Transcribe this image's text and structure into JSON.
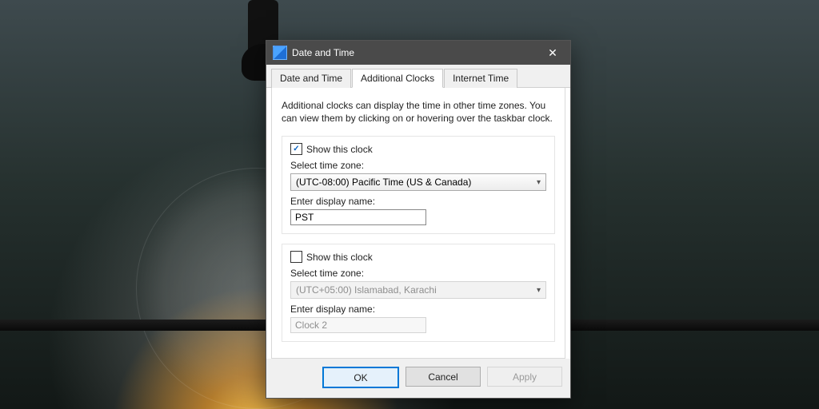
{
  "window": {
    "title": "Date and Time",
    "close_glyph": "✕"
  },
  "tabs": {
    "date_time": "Date and Time",
    "additional_clocks": "Additional Clocks",
    "internet_time": "Internet Time"
  },
  "description": "Additional clocks can display the time in other time zones. You can view them by clicking on or hovering over the taskbar clock.",
  "labels": {
    "show_this_clock": "Show this clock",
    "select_time_zone": "Select time zone:",
    "enter_display_name": "Enter display name:"
  },
  "clock1": {
    "checked": true,
    "timezone": "(UTC-08:00) Pacific Time (US & Canada)",
    "display_name": "PST"
  },
  "clock2": {
    "checked": false,
    "timezone": "(UTC+05:00) Islamabad, Karachi",
    "display_name": "Clock 2"
  },
  "buttons": {
    "ok": "OK",
    "cancel": "Cancel",
    "apply": "Apply"
  }
}
